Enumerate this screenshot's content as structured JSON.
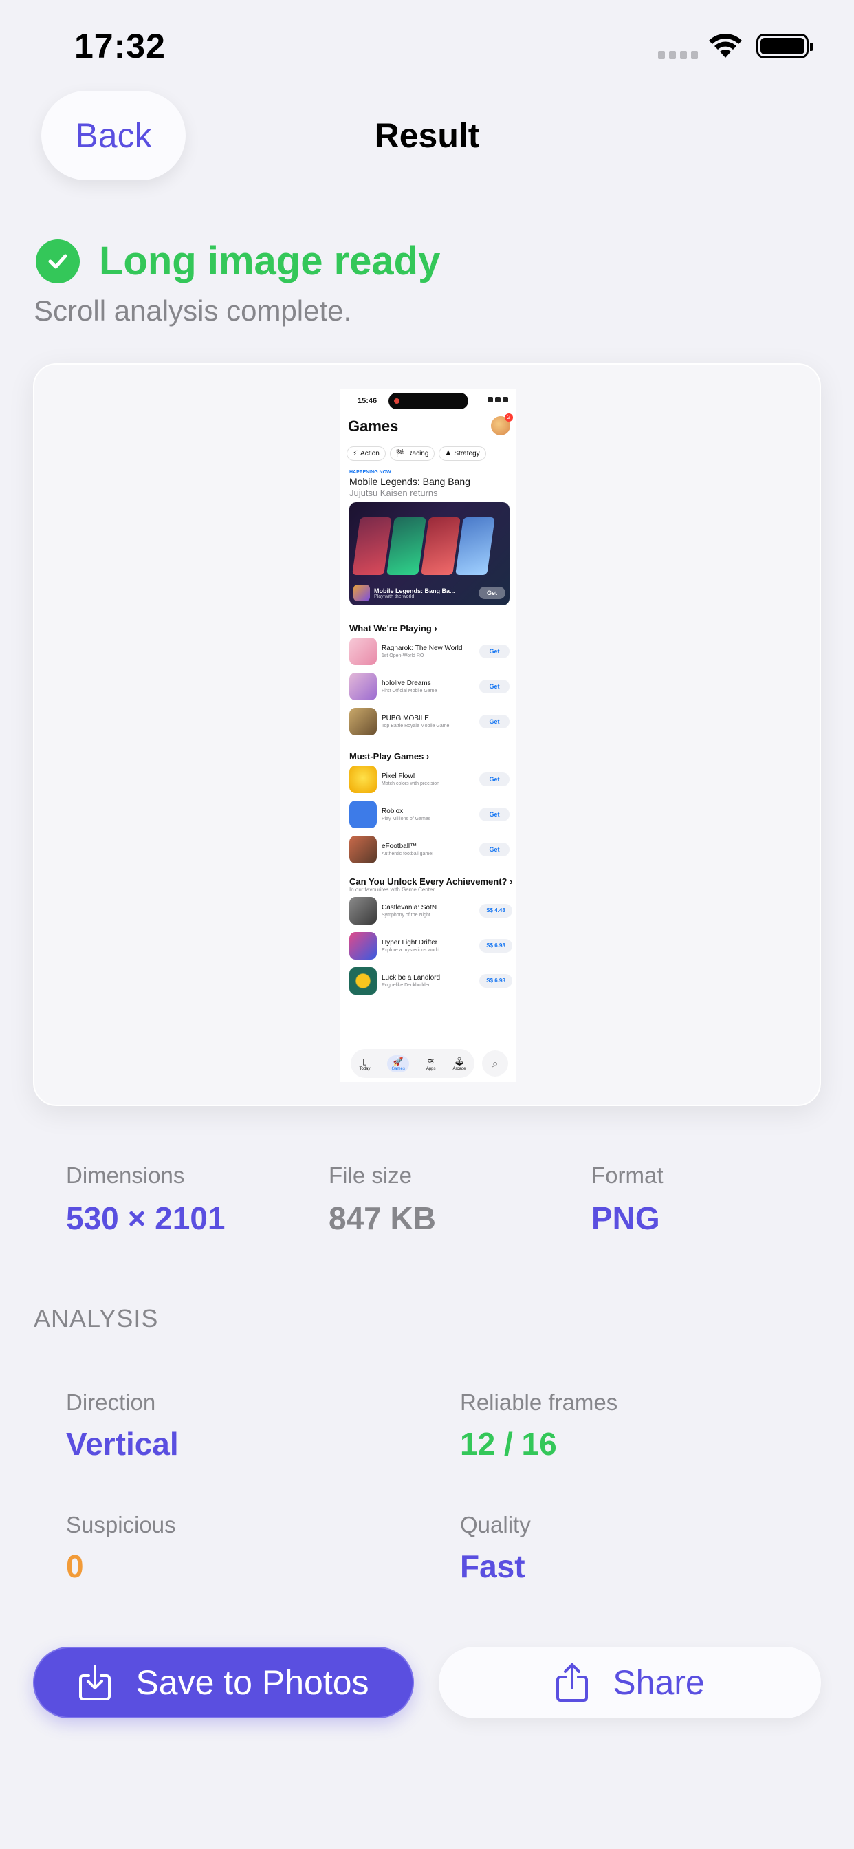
{
  "status_bar": {
    "time": "17:32"
  },
  "nav": {
    "back_label": "Back",
    "title": "Result"
  },
  "result": {
    "status_title": "Long image ready",
    "status_subtitle": "Scroll analysis complete.",
    "status_icon": "checkmark-circle-icon"
  },
  "preview": {
    "time": "15:46",
    "page_title": "Games",
    "badge_count": "2",
    "chips": [
      {
        "icon": "action-icon",
        "label": "Action"
      },
      {
        "icon": "racing-icon",
        "label": "Racing"
      },
      {
        "icon": "strategy-icon",
        "label": "Strategy"
      }
    ],
    "happening": "HAPPENING NOW",
    "feature_title": "Mobile Legends: Bang Bang",
    "feature_subtitle": "Jujutsu Kaisen returns",
    "feature_app_name": "Mobile Legends: Bang Ba...",
    "feature_app_tag": "Play with the world!",
    "feature_get": "Get",
    "sections": [
      {
        "title": "What We're Playing",
        "subtitle": "",
        "apps": [
          {
            "name": "Ragnarok: The New World",
            "tag": "1st Open-World RO",
            "action": "Get",
            "color": "#f2a7c0"
          },
          {
            "name": "hololive Dreams",
            "tag": "First Official Mobile Game",
            "action": "Get",
            "color": "#c97ab6"
          },
          {
            "name": "PUBG MOBILE",
            "tag": "Top Battle Royale Mobile Game",
            "action": "Get",
            "color": "#8a7350"
          }
        ]
      },
      {
        "title": "Must-Play Games",
        "subtitle": "",
        "apps": [
          {
            "name": "Pixel Flow!",
            "tag": "Match colors with precision",
            "action": "Get",
            "color": "#f7c51e"
          },
          {
            "name": "Roblox",
            "tag": "Play Millions of Games",
            "action": "Get",
            "color": "#3d7be8"
          },
          {
            "name": "eFootball™",
            "tag": "Authentic football game!",
            "action": "Get",
            "color": "#a44a3a"
          }
        ]
      },
      {
        "title": "Can You Unlock Every Achievement?",
        "subtitle": "In our favourites with Game Center",
        "apps": [
          {
            "name": "Castlevania: SotN",
            "tag": "Symphony of the Night",
            "action": "S$ 4.48",
            "color": "#5a5a5a"
          },
          {
            "name": "Hyper Light Drifter",
            "tag": "Explore a mysterious world",
            "action": "S$ 6.98",
            "color": "#e04a8a"
          },
          {
            "name": "Luck be a Landlord",
            "tag": "Roguelike Deckbuilder",
            "action": "S$ 6.98",
            "color": "#1f8a6a"
          }
        ]
      }
    ],
    "tabs": [
      {
        "icon": "today-icon",
        "label": "Today"
      },
      {
        "icon": "games-icon",
        "label": "Games"
      },
      {
        "icon": "apps-icon",
        "label": "Apps"
      },
      {
        "icon": "arcade-icon",
        "label": "Arcade"
      }
    ]
  },
  "file_info": {
    "dimensions_label": "Dimensions",
    "dimensions_value": "530 × 2101",
    "size_label": "File size",
    "size_value": "847 KB",
    "format_label": "Format",
    "format_value": "PNG"
  },
  "analysis": {
    "header": "ANALYSIS",
    "direction_label": "Direction",
    "direction_value": "Vertical",
    "frames_label": "Reliable frames",
    "frames_value": "12 / 16",
    "suspicious_label": "Suspicious",
    "suspicious_value": "0",
    "quality_label": "Quality",
    "quality_value": "Fast"
  },
  "actions": {
    "save_label": "Save to Photos",
    "share_label": "Share"
  },
  "colors": {
    "accent": "#5a4fe0",
    "success": "#34c759",
    "warning": "#f29b38",
    "secondary_text": "#86868b",
    "background": "#f2f2f7"
  }
}
